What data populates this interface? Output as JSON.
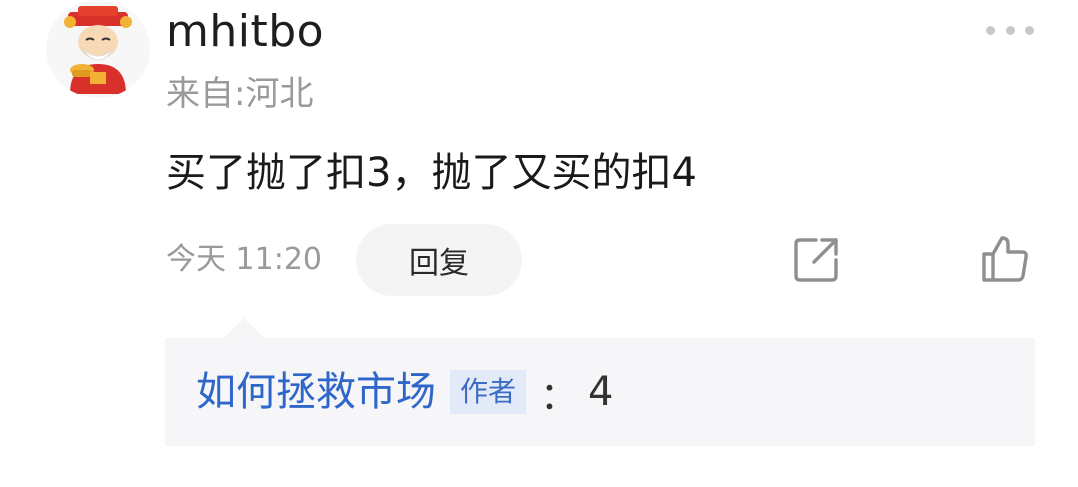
{
  "post": {
    "username": "mhitbo",
    "location": "来自:河北",
    "text": "买了抛了扣3，抛了又买的扣4",
    "timestamp": "今天 11:20",
    "reply_label": "回复",
    "icons": {
      "more": "more-icon",
      "share": "share-icon",
      "like": "thumbs-up-icon",
      "avatar": "avatar-icon"
    }
  },
  "reply": {
    "author": "如何拯救市场",
    "badge": "作者",
    "separator": "：",
    "content": "4"
  },
  "colors": {
    "username": "#1e1e1e",
    "meta_gray": "#9a9a9a",
    "reply_author_blue": "#2f66c9",
    "badge_bg": "#e2e9f7",
    "reply_box_bg": "#f6f6f8"
  }
}
